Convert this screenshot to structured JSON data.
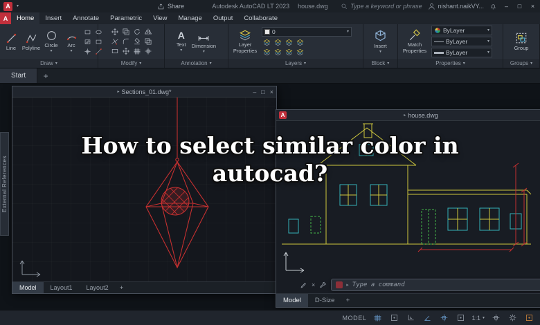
{
  "icons": {
    "logo_letter": "A",
    "caret_down": "▾",
    "caret_right": "▸",
    "close": "×",
    "minimize": "–",
    "maximize": "□",
    "plus": "+",
    "text_tool_glyph": "A"
  },
  "titlebar": {
    "share_label": "Share",
    "app_title": "Autodesk AutoCAD LT 2023",
    "doc_title": "house.dwg",
    "search_placeholder": "Type a keyword or phrase",
    "user_name": "nishant.naikVY..."
  },
  "menu": {
    "tabs": [
      {
        "label": "Home"
      },
      {
        "label": "Insert"
      },
      {
        "label": "Annotate"
      },
      {
        "label": "Parametric"
      },
      {
        "label": "View"
      },
      {
        "label": "Manage"
      },
      {
        "label": "Output"
      },
      {
        "label": "Collaborate"
      }
    ]
  },
  "ribbon": {
    "draw_label": "Draw",
    "tools": {
      "line": "Line",
      "polyline": "Polyline",
      "circle": "Circle",
      "arc": "Arc"
    },
    "modify_label": "Modify",
    "annotation_label": "Annotation",
    "text_label": "Text",
    "dimension_label": "Dimension",
    "layer_properties_label": "Layer Properties",
    "layers_label": "Layers",
    "current_layer": "0",
    "block_label": "Block",
    "insert_label": "Insert",
    "properties_label": "Properties",
    "match_properties_label": "Match Properties",
    "color_value": "ByLayer",
    "linetype_value": "ByLayer",
    "lineweight_value": "ByLayer",
    "groups_label": "Groups",
    "group_label": "Group"
  },
  "file_tabs": {
    "start": "Start"
  },
  "external_references_label": "External References",
  "sections_window": {
    "title": "Sections_01.dwg*",
    "tabs": [
      "Model",
      "Layout1",
      "Layout2"
    ]
  },
  "house_window": {
    "title": "house.dwg",
    "command_placeholder": "Type a command",
    "tabs": [
      "Model",
      "D-Size"
    ]
  },
  "overlay": {
    "line1": "How to select similar color in",
    "line2": "autocad?"
  },
  "status": {
    "model_label": "MODEL",
    "scale": "1:1"
  },
  "colors": {
    "accent_red": "#c2303c",
    "drawing_red": "#c43030",
    "house_yellow": "#cfc83e",
    "house_cyan": "#35b2b8",
    "house_green": "#43b34a"
  }
}
